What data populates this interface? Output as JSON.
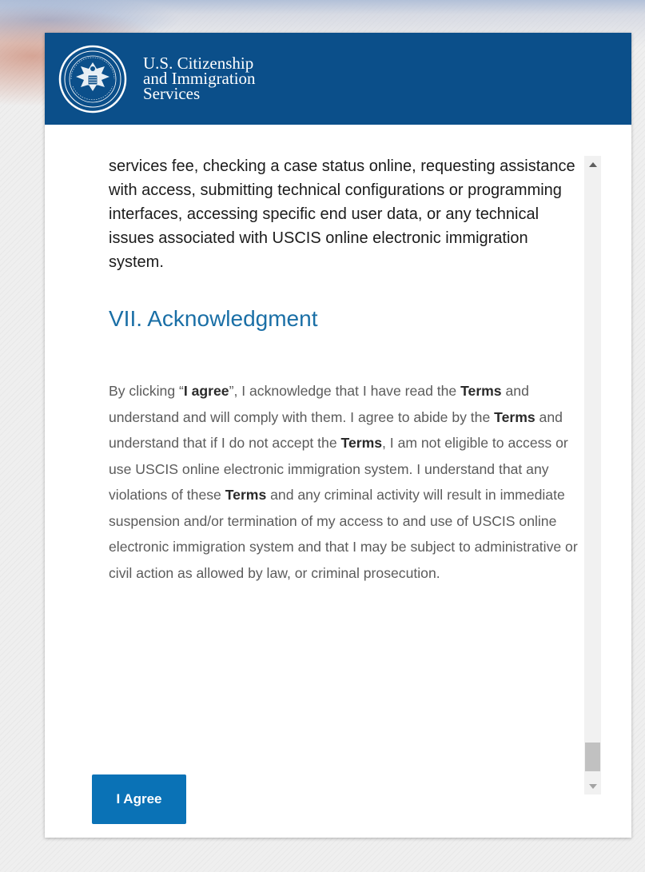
{
  "header": {
    "agency_line1": "U.S. Citizenship",
    "agency_line2": "and Immigration",
    "agency_line3": "Services",
    "bg_color": "#0b4f8a"
  },
  "terms": {
    "intro_paragraph": "services fee, checking a case status online, requesting assistance with access, submitting technical configurations or programming interfaces, accessing specific end user data, or any technical issues associated with USCIS online electronic immigration system.",
    "section_heading": "VII. Acknowledgment",
    "ack": {
      "s1": "By clicking “",
      "b1": "I agree",
      "s2": "”, I acknowledge that I have read the ",
      "b2": "Terms",
      "s3": " and understand and will comply with them. I agree to abide by the ",
      "b3": "Terms",
      "s4": " and understand that if I do not accept the ",
      "b4": "Terms",
      "s5": ", I am not eligible to access or use USCIS online electronic immigration system. I understand that any violations of these ",
      "b5": "Terms",
      "s6": " and any criminal activity will result in immediate suspension and/or termination of my access to and use of USCIS online electronic immigration system and that I may be subject to administrative or civil action as allowed by law, or criminal prosecution."
    }
  },
  "actions": {
    "agree_label": "I Agree",
    "button_color": "#0a72b6"
  },
  "colors": {
    "heading": "#1a6fa6",
    "body_text": "#5b5b5b"
  },
  "icons": {
    "seal": "dhs-seal-icon",
    "scroll_up": "triangle-up-icon",
    "scroll_down": "triangle-down-icon"
  }
}
